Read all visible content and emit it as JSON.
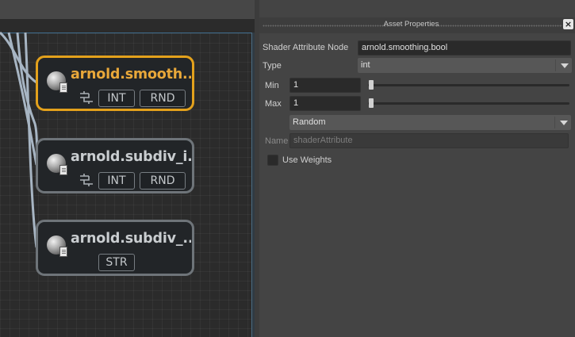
{
  "graph": {
    "nodes": [
      {
        "title": "arnold.smooth...",
        "tags": [
          "INT",
          "RND"
        ],
        "selected": true
      },
      {
        "title": "arnold.subdiv_i...",
        "tags": [
          "INT",
          "RND"
        ],
        "selected": false
      },
      {
        "title": "arnold.subdiv_...",
        "tags": [
          "STR"
        ],
        "selected": false
      }
    ]
  },
  "panel": {
    "title": "Asset Properties",
    "close_label": "×",
    "shader_attribute_node_label": "Shader Attribute Node",
    "shader_attribute_node_value": "arnold.smoothing.bool",
    "type_label": "Type",
    "type_value": "int",
    "min_label": "Min",
    "min_value": "1",
    "max_label": "Max",
    "max_value": "1",
    "mode_value": "Random",
    "name_label": "Name",
    "name_placeholder": "shaderAttribute",
    "use_weights_label": "Use Weights",
    "use_weights_checked": false
  }
}
